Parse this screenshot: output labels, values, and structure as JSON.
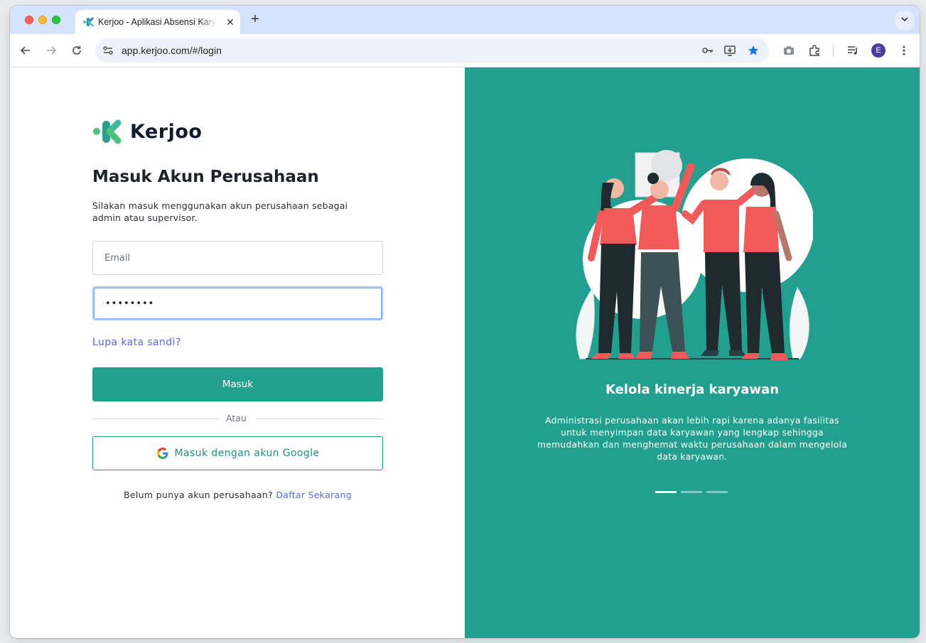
{
  "browser": {
    "tab": {
      "title": "Kerjoo - Aplikasi Absensi Karyawan",
      "close_icon": "close-icon"
    },
    "new_tab_icon": "plus-icon",
    "tab_search_icon": "chevron-down-icon",
    "url": "app.kerjoo.com/#/login",
    "avatar_letter": "E",
    "colors": {
      "tabstrip": "#d3e3fd",
      "omnibox": "#edf2fa",
      "star": "#1a73e8",
      "avatar": "#4b3c9e"
    }
  },
  "login": {
    "logo_text": "Kerjoo",
    "title": "Masuk Akun Perusahaan",
    "subtitle": "Silakan masuk menggunakan akun perusahaan sebagai admin atau supervisor.",
    "email_placeholder": "Email",
    "password_value": "••••••••",
    "forgot_label": "Lupa kata sandi?",
    "submit_label": "Masuk",
    "divider_label": "Atau",
    "google_label": "Masuk dengan akun Google",
    "signup_prompt": "Belum punya akun perusahaan?",
    "signup_link": "Daftar Sekarang",
    "colors": {
      "primary": "#22a08f",
      "link": "#5b6ae0"
    }
  },
  "carousel": {
    "title": "Kelola kinerja karyawan",
    "text": "Administrasi perusahaan akan lebih rapi karena adanya fasilitas untuk menyimpan data karyawan yang lengkap sehingga memudahkan dan menghemat waktu perusahaan dalam mengelola data karyawan.",
    "active_index": 0,
    "slides": 3,
    "colors": {
      "background": "#22a08f",
      "shirt": "#f25a5a",
      "pants": "#1f2a2e"
    }
  }
}
